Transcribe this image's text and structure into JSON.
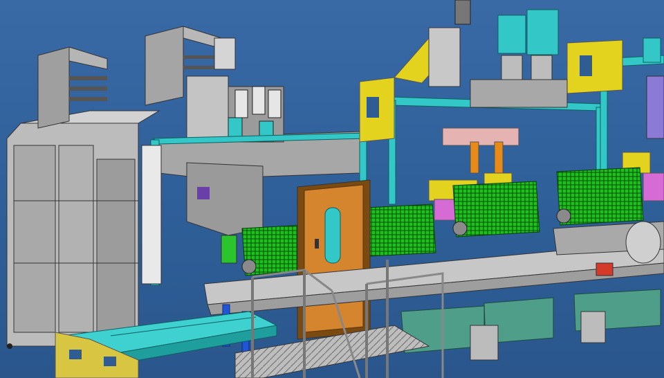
{
  "scene": {
    "background": "#2f5d93",
    "subject": "cad-assembly-machine",
    "palette": {
      "frame_gray": "#b9b9b9",
      "dark_gray": "#8a8a8a",
      "cyan": "#33c7c7",
      "yellow": "#e3d21e",
      "green": "#22d21e",
      "orange": "#d5852e",
      "teal_panel": "#4f9e8a",
      "magenta": "#d66bd6",
      "blue_part": "#1f55d6",
      "red_part": "#d43a2a"
    }
  }
}
